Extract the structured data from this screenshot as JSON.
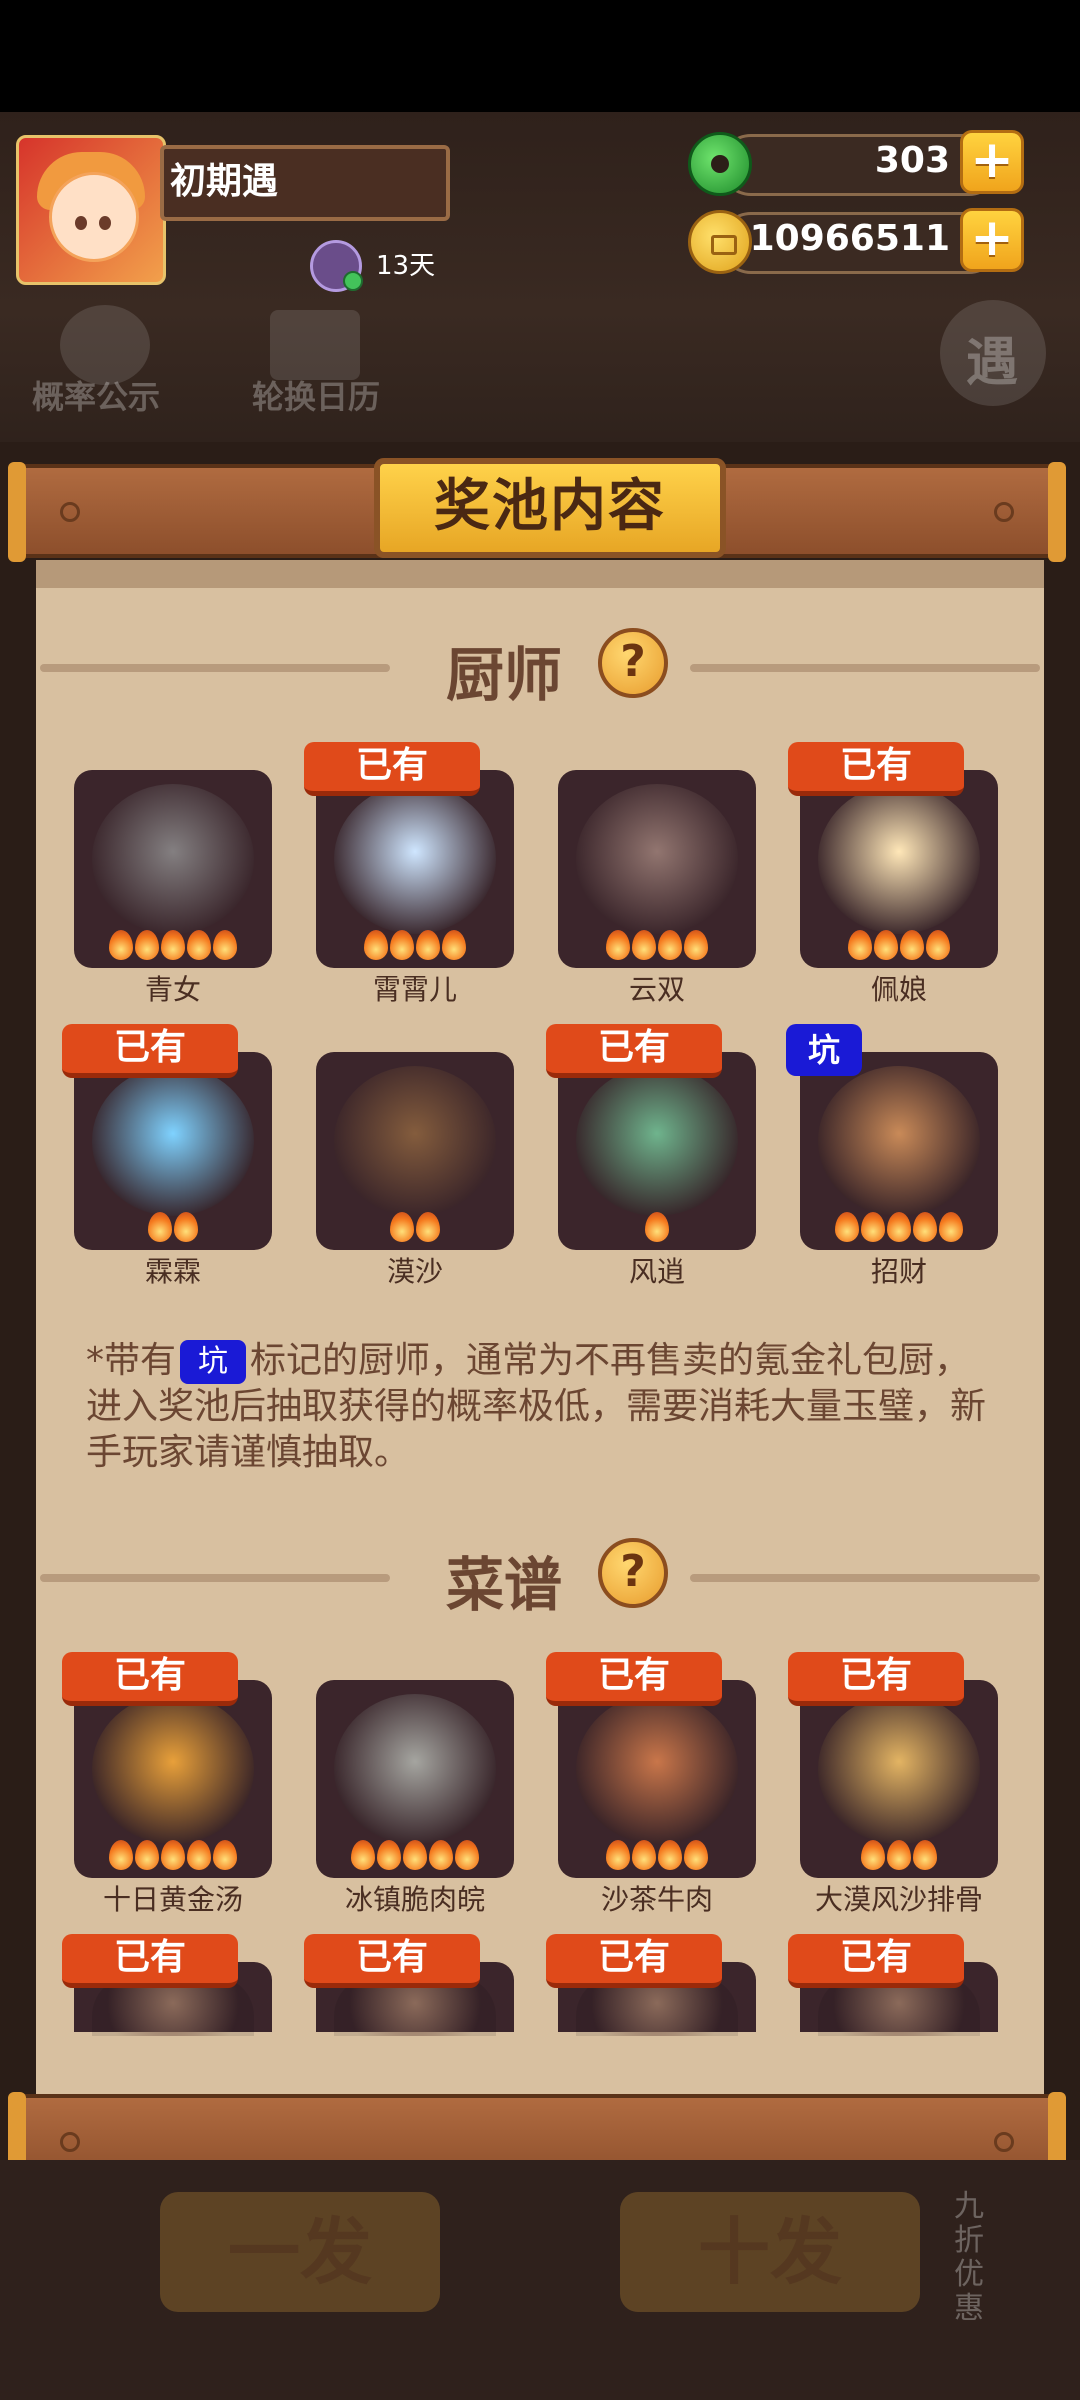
{
  "player": {
    "name": "初期遇",
    "days": "13天"
  },
  "currency": {
    "jade": "303",
    "gold": "10966511"
  },
  "background_buttons": {
    "probability": "概率公示",
    "calendar": "轮换日历",
    "meet": "遇",
    "single_draw": "一发",
    "ten_draw": "十发",
    "discount": "九折优惠"
  },
  "panel": {
    "title": "奖池内容",
    "chef_section_title": "厨师",
    "recipe_section_title": "菜谱",
    "owned_label": "已有",
    "pit_label": "坑",
    "note_prefix": "*带有",
    "note_suffix": "标记的厨师，通常为不再售卖的氪金礼包厨，进入奖池后抽取获得的概率极低，需要消耗大量玉璧，新手玩家请谨慎抽取。"
  },
  "chefs": [
    {
      "name": "青女",
      "owned": false,
      "stars": 5,
      "color": "#bfc9c7"
    },
    {
      "name": "霄霄儿",
      "owned": true,
      "stars": 4,
      "color": "#cfe6ff"
    },
    {
      "name": "云双",
      "owned": false,
      "stars": 4,
      "color": "#d9b7a8"
    },
    {
      "name": "佩娘",
      "owned": true,
      "stars": 4,
      "color": "#ffe7b8"
    },
    {
      "name": "霖霖",
      "owned": true,
      "stars": 2,
      "color": "#7fd2ff"
    },
    {
      "name": "漠沙",
      "owned": false,
      "stars": 2,
      "color": "#c08a4c"
    },
    {
      "name": "风逍",
      "owned": true,
      "stars": 1,
      "color": "#6fb48d"
    },
    {
      "name": "招财",
      "owned": false,
      "pit": true,
      "stars": 5,
      "color": "#c98a58"
    }
  ],
  "recipes": [
    {
      "name": "十日黄金汤",
      "owned": true,
      "stars": 5,
      "color": "#e8a03a"
    },
    {
      "name": "冰镇脆肉皖",
      "owned": false,
      "stars": 5,
      "color": "#a5a5a0"
    },
    {
      "name": "沙茶牛肉",
      "owned": true,
      "stars": 4,
      "color": "#c9764a"
    },
    {
      "name": "大漠风沙排骨",
      "owned": true,
      "stars": 3,
      "color": "#e3b463"
    },
    {
      "name": "",
      "owned": true,
      "stars": 0,
      "color": "#8b6a5a"
    },
    {
      "name": "",
      "owned": true,
      "stars": 0,
      "color": "#8b6a5a"
    },
    {
      "name": "",
      "owned": true,
      "stars": 0,
      "color": "#8b6a5a"
    },
    {
      "name": "",
      "owned": true,
      "stars": 0,
      "color": "#8b6a5a"
    }
  ]
}
